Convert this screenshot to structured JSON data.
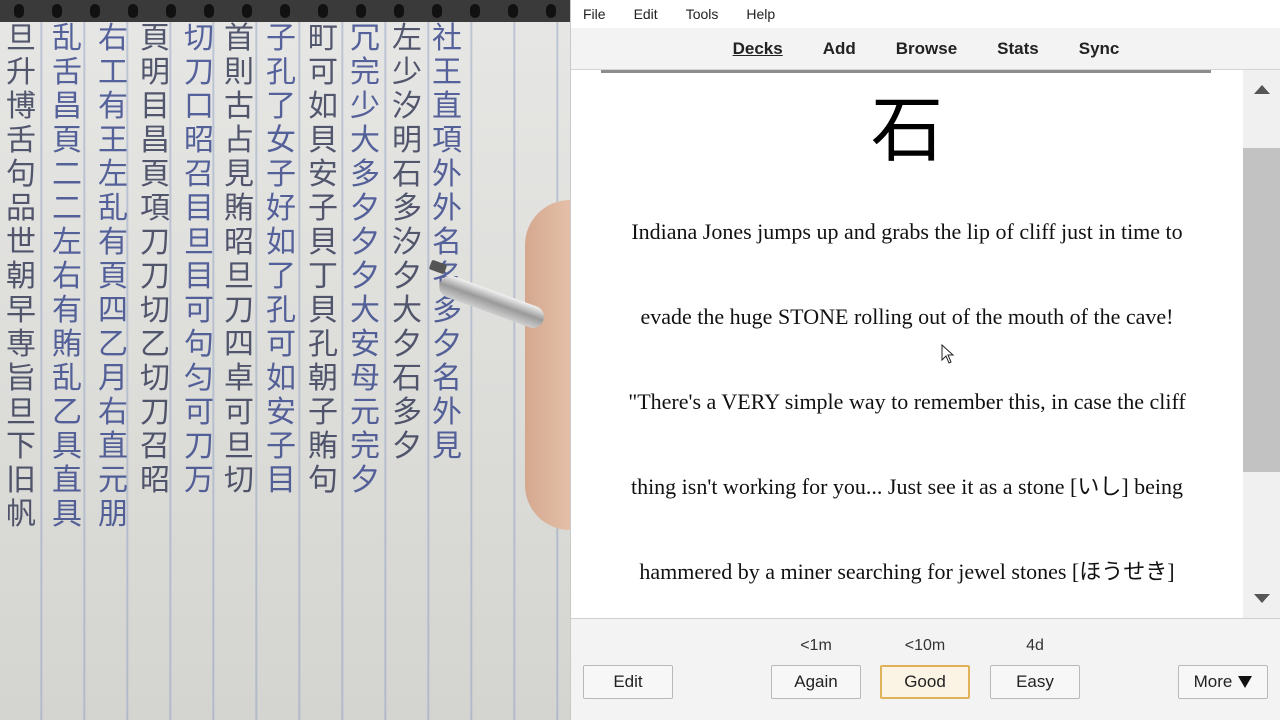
{
  "menubar": {
    "items": [
      "File",
      "Edit",
      "Tools",
      "Help"
    ]
  },
  "toolbar": {
    "links": [
      "Decks",
      "Add",
      "Browse",
      "Stats",
      "Sync"
    ],
    "active": "Decks"
  },
  "card": {
    "kanji": "石",
    "story_lines": [
      "Indiana Jones jumps up and grabs the lip of cliff just in time to",
      "evade the huge STONE rolling out of the mouth of the cave!",
      "\"There's a VERY simple way to remember this, in case the cliff",
      "thing isn't working for you... Just see it as a stone [いし] being",
      "hammered by a miner searching for jewel stones [ほうせき]"
    ]
  },
  "bottom": {
    "edit_label": "Edit",
    "more_label": "More",
    "answers": [
      {
        "label": "Again",
        "interval": "<1m"
      },
      {
        "label": "Good",
        "interval": "<10m"
      },
      {
        "label": "Easy",
        "interval": "4d"
      }
    ]
  },
  "photo": {
    "columns": [
      "旦升博舌句品世朝早専旨旦下旧帆",
      "乱舌昌頁二二左右有賄乱乙具直具",
      "右工有王左乱有頁四乙月右直元朋",
      "頁明目昌頁項刀刀切乙切刀召昭",
      "切刀口昭召目旦目可句匀可刀万",
      "首則古占見賄昭旦刀四卓可旦切",
      "子孔了女子好如了孔可如安子目",
      "町可如貝安子貝丁貝孔朝子賄句",
      "冗完少大多夕夕夕大安母元完夕",
      "左少汐明石多汐夕大夕石多夕",
      "社王直項外外名名多夕名外見"
    ]
  }
}
